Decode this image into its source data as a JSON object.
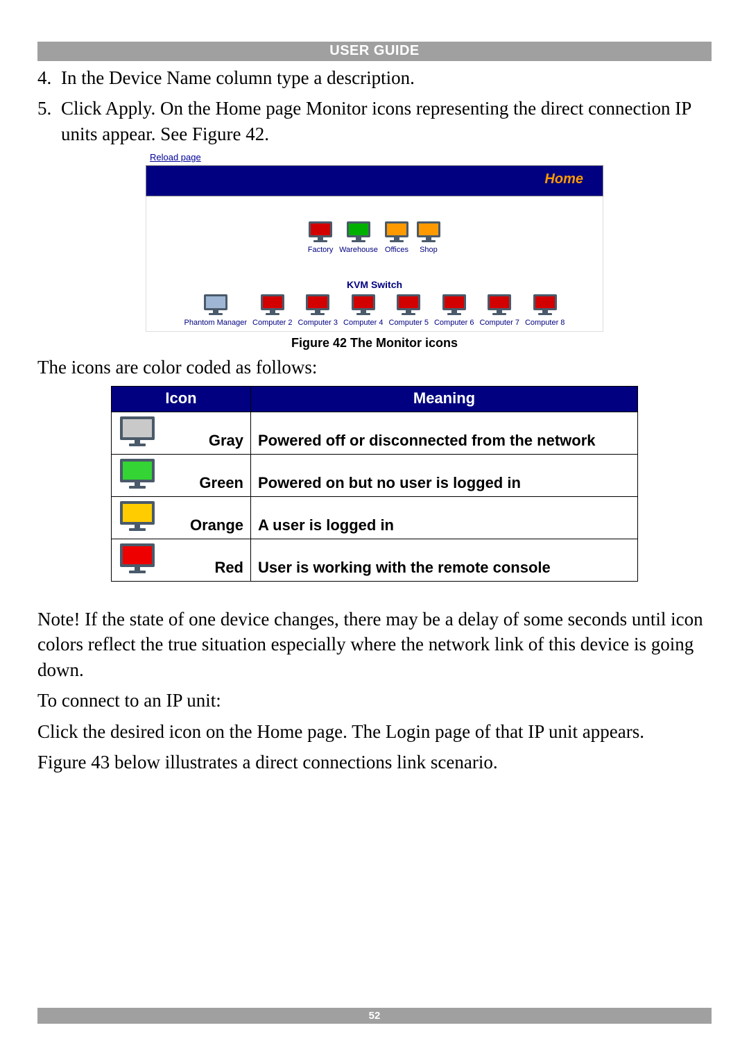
{
  "header": {
    "title": "USER GUIDE"
  },
  "steps": [
    {
      "n": "4.",
      "t": "In the Device Name column type a description."
    },
    {
      "n": "5.",
      "t": "Click Apply. On the Home page Monitor icons representing the direct connection IP units appear. See Figure 42."
    }
  ],
  "figure42": {
    "reload": "Reload page",
    "home": "Home",
    "row1": [
      {
        "color": "#d30000",
        "label": "Factory"
      },
      {
        "color": "#00b000",
        "label": "Warehouse"
      },
      {
        "color": "#ff9900",
        "label": "Offices"
      },
      {
        "color": "#ff9900",
        "label": "Shop"
      }
    ],
    "kvm_title": "KVM Switch",
    "row2": [
      {
        "color": "#9fb7d4",
        "label": "Phantom Manager"
      },
      {
        "color": "#d30000",
        "label": "Computer 2"
      },
      {
        "color": "#d30000",
        "label": "Computer 3"
      },
      {
        "color": "#d30000",
        "label": "Computer 4"
      },
      {
        "color": "#d30000",
        "label": "Computer 5"
      },
      {
        "color": "#d30000",
        "label": "Computer 6"
      },
      {
        "color": "#d30000",
        "label": "Computer 7"
      },
      {
        "color": "#d30000",
        "label": "Computer 8"
      }
    ],
    "caption": "Figure 42 The Monitor icons"
  },
  "after_figure": "The icons are color coded as follows:",
  "legend": {
    "headers": {
      "icon": "Icon",
      "meaning": "Meaning"
    },
    "rows": [
      {
        "screen": "#c9c9c9",
        "label": "Gray",
        "meaning": "Powered off or disconnected from the network"
      },
      {
        "screen": "#33d433",
        "label": "Green",
        "meaning": "Powered on but no user is logged in"
      },
      {
        "screen": "#ffcc00",
        "label": "Orange",
        "meaning": "A user is logged in"
      },
      {
        "screen": "#ee0000",
        "label": "Red",
        "meaning": "User is working with the remote console"
      }
    ]
  },
  "paras": {
    "note": "Note! If the state of one device changes, there may be a delay of some seconds until icon colors reflect the true situation especially where the network link of this device is going down.",
    "connect": "To connect to an IP unit:",
    "click": "Click the desired icon on the Home page. The Login page of that IP unit appears.",
    "fig43": "Figure 43 below illustrates a direct connections link scenario."
  },
  "footer": {
    "page": "52"
  }
}
